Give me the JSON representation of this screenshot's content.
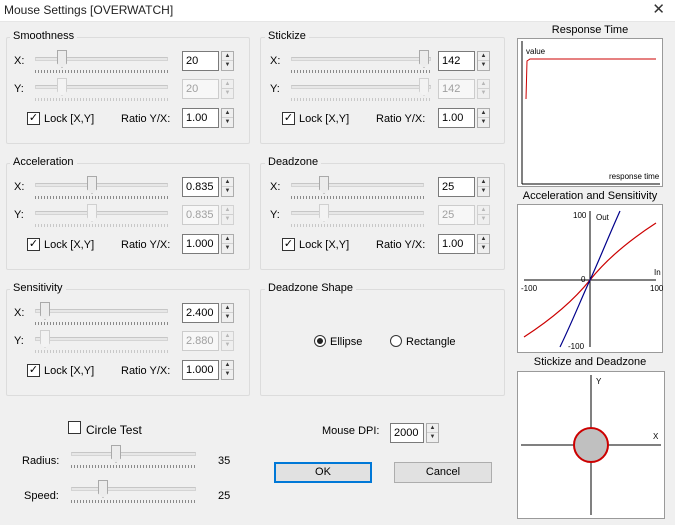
{
  "window": {
    "title": "Mouse Settings [OVERWATCH]",
    "close_glyph": "✕"
  },
  "smoothness": {
    "title": "Smoothness",
    "x_label": "X:",
    "y_label": "Y:",
    "x_value": "20",
    "y_value": "20",
    "lock_label": "Lock [X,Y]",
    "lock_checked": true,
    "ratio_label": "Ratio Y/X:",
    "ratio_value": "1.00"
  },
  "stickize": {
    "title": "Stickize",
    "x_label": "X:",
    "y_label": "Y:",
    "x_value": "142",
    "y_value": "142",
    "lock_label": "Lock [X,Y]",
    "lock_checked": true,
    "ratio_label": "Ratio Y/X:",
    "ratio_value": "1.00"
  },
  "acceleration": {
    "title": "Acceleration",
    "x_label": "X:",
    "y_label": "Y:",
    "x_value": "0.835",
    "y_value": "0.835",
    "lock_label": "Lock [X,Y]",
    "lock_checked": true,
    "ratio_label": "Ratio Y/X:",
    "ratio_value": "1.000"
  },
  "deadzone": {
    "title": "Deadzone",
    "x_label": "X:",
    "y_label": "Y:",
    "x_value": "25",
    "y_value": "25",
    "lock_label": "Lock [X,Y]",
    "lock_checked": true,
    "ratio_label": "Ratio Y/X:",
    "ratio_value": "1.00"
  },
  "sensitivity": {
    "title": "Sensitivity",
    "x_label": "X:",
    "y_label": "Y:",
    "x_value": "2.400",
    "y_value": "2.880",
    "lock_label": "Lock [X,Y]",
    "lock_checked": true,
    "ratio_label": "Ratio Y/X:",
    "ratio_value": "1.000"
  },
  "deadzone_shape": {
    "title": "Deadzone Shape",
    "options": [
      "Ellipse",
      "Rectangle"
    ],
    "selected": "Ellipse"
  },
  "circle_test": {
    "label": "Circle Test",
    "checked": false,
    "radius_label": "Radius:",
    "radius_value": "35",
    "speed_label": "Speed:",
    "speed_value": "25"
  },
  "mouse_dpi": {
    "label": "Mouse DPI:",
    "value": "2000"
  },
  "buttons": {
    "ok": "OK",
    "cancel": "Cancel"
  },
  "graphs": {
    "response_time": {
      "title": "Response Time",
      "y_label": "value",
      "x_label": "response time"
    },
    "accel_sens": {
      "title": "Acceleration and Sensitivity",
      "y_label": "Out",
      "x_label": "In",
      "ticks": {
        "y_top": "100",
        "y_bottom": "-100",
        "x_left": "-100",
        "x_right": "100",
        "origin": "0"
      }
    },
    "stickize_deadzone": {
      "title": "Stickize and Deadzone",
      "y_label": "Y",
      "x_label": "X"
    }
  },
  "colors": {
    "curve_red": "#cc0000",
    "curve_blue": "#00008b",
    "deadzone_fill": "#c0c0c0",
    "default_button_border": "#0078d7"
  },
  "icons": {
    "check": "✓",
    "spin_up": "▲",
    "spin_down": "▼"
  }
}
